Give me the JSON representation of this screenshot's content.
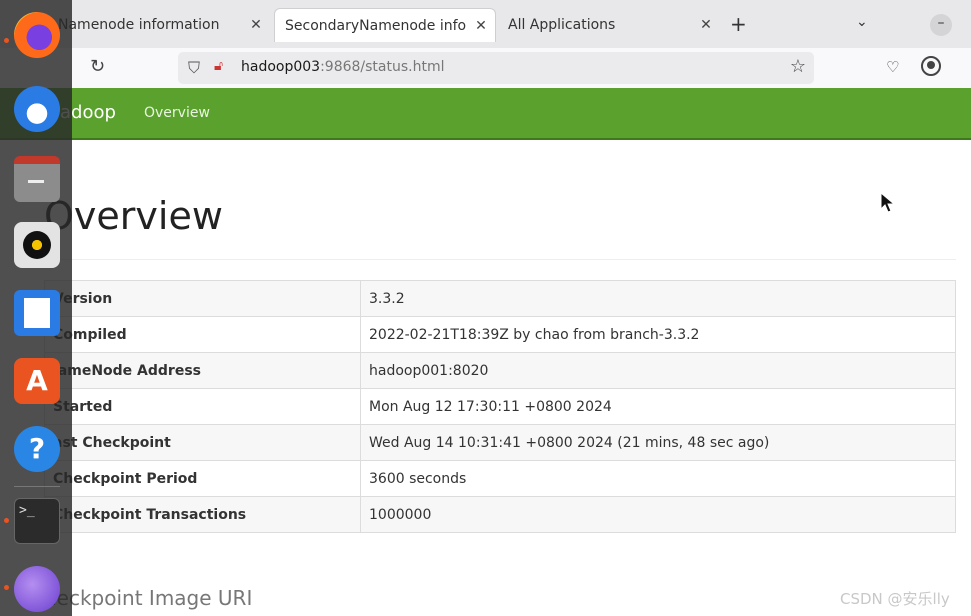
{
  "browser": {
    "tabs": [
      {
        "label": "Namenode information",
        "close": "✕",
        "active": false
      },
      {
        "label": "SecondaryNamenode information",
        "close": "✕",
        "active": true
      },
      {
        "label": "All Applications",
        "close": "✕",
        "active": false
      }
    ],
    "new_tab_icon": "+",
    "tab_list_icon": "⌄",
    "minimize_icon": "–",
    "url_host": "hadoop003",
    "url_rest": ":9868/status.html"
  },
  "site": {
    "brand": "adoop",
    "nav_overview": "Overview",
    "nav_color": "#5aa12e"
  },
  "page": {
    "title": "Overview",
    "rows": [
      {
        "key": "Version",
        "value": "3.3.2"
      },
      {
        "key": "Compiled",
        "value": "2022-02-21T18:39Z by chao from branch-3.3.2"
      },
      {
        "key": "lameNode Address",
        "value": "hadoop001:8020"
      },
      {
        "key": "Started",
        "value": "Mon Aug 12 17:30:11 +0800 2024"
      },
      {
        "key": "ast Checkpoint",
        "value": "Wed Aug 14 10:31:41 +0800 2024 (21 mins, 48 sec ago)"
      },
      {
        "key": "Checkpoint Period",
        "value": "3600 seconds"
      },
      {
        "key": "Checkpoint Transactions",
        "value": "1000000"
      }
    ],
    "subheading": "heckpoint Image URI"
  },
  "dock": {
    "terminal_prompt": ">_",
    "software_glyph": "A",
    "help_glyph": "?"
  },
  "watermark": "CSDN @安乐lly"
}
